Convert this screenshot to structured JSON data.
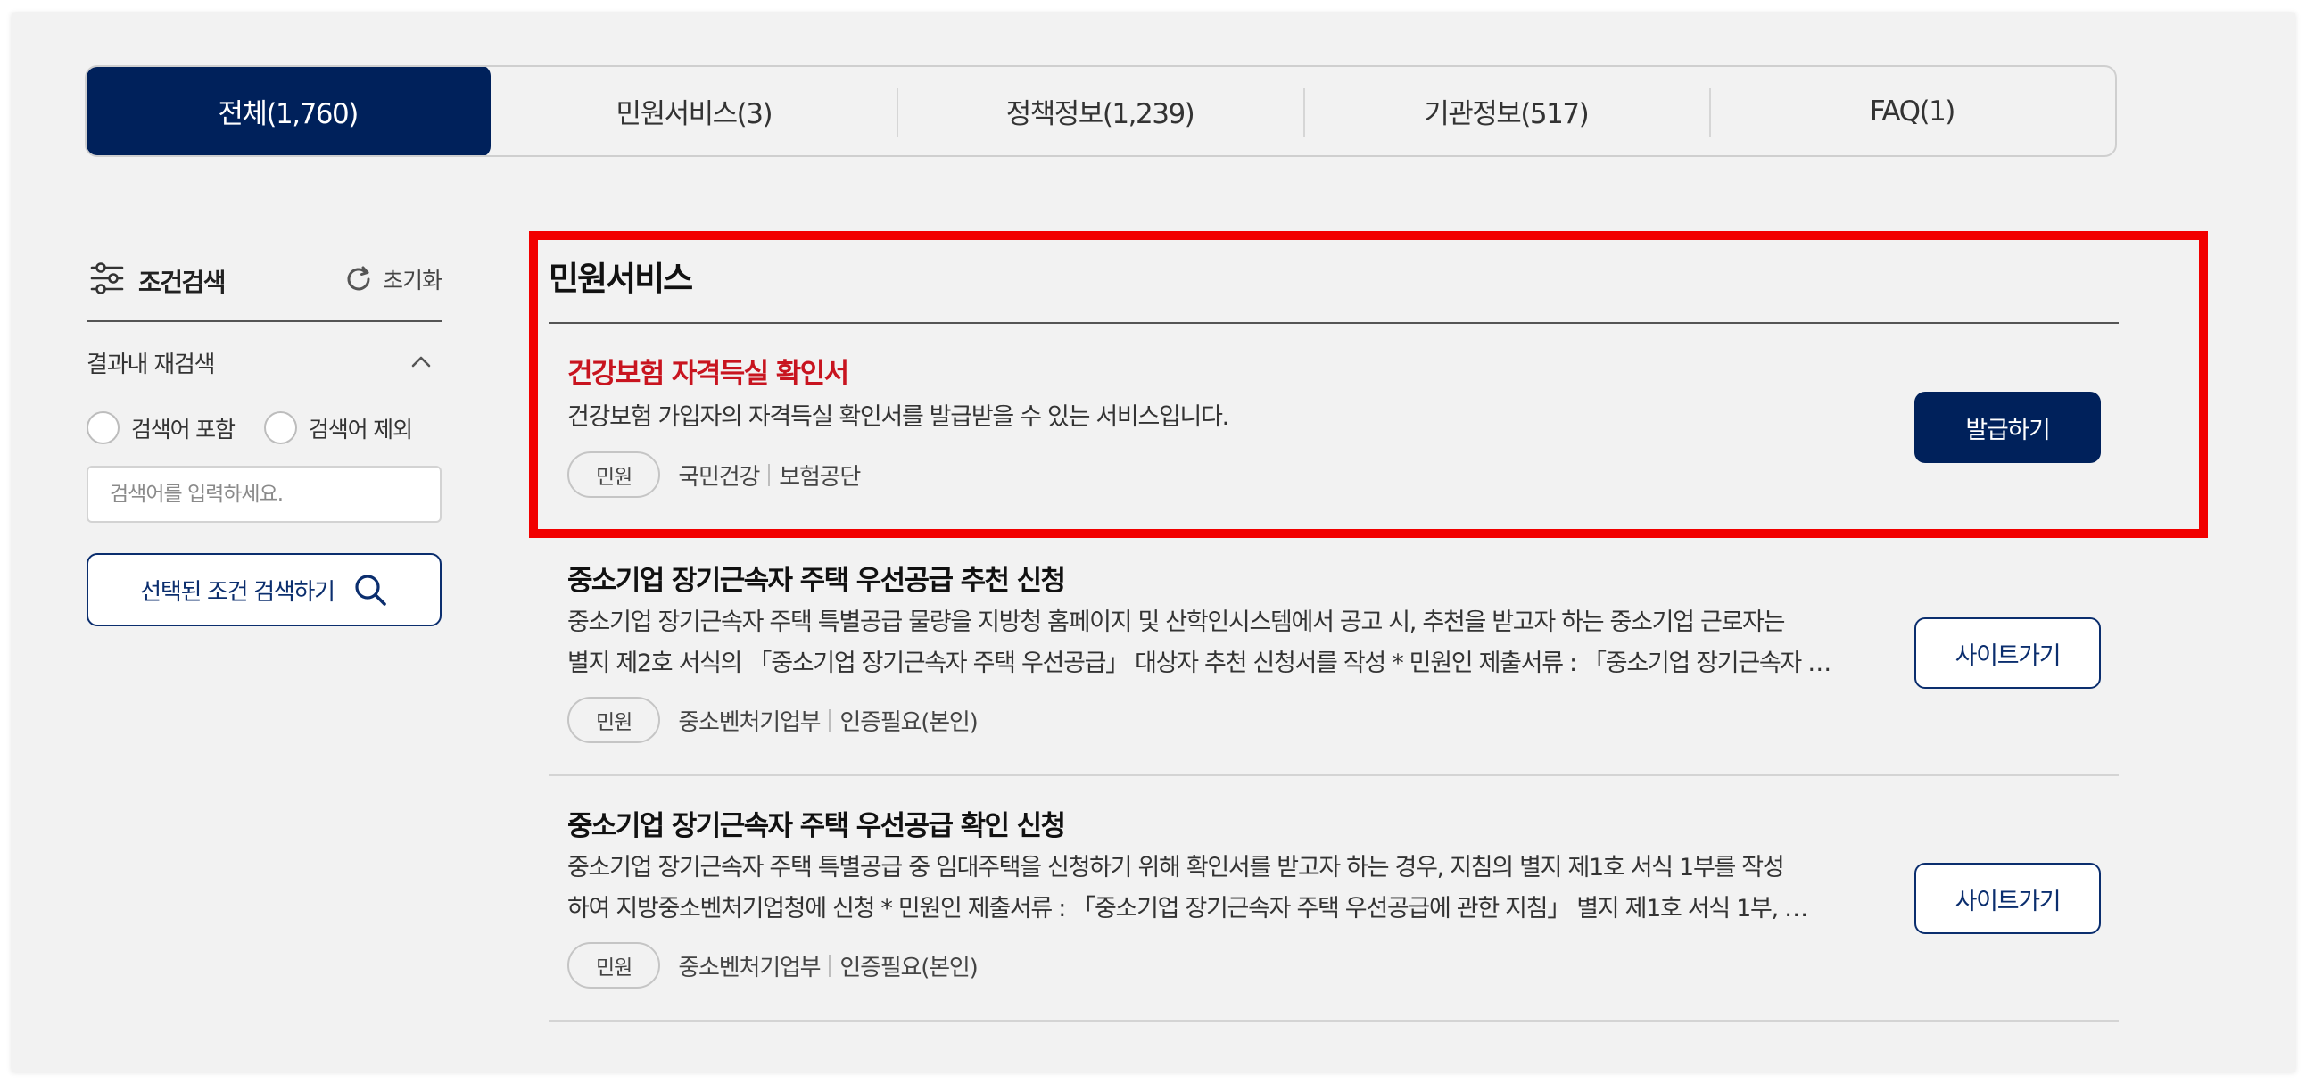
{
  "tabs": [
    {
      "label": "전체(1,760)",
      "active": true
    },
    {
      "label": "민원서비스(3)",
      "active": false
    },
    {
      "label": "정책정보(1,239)",
      "active": false
    },
    {
      "label": "기관정보(517)",
      "active": false
    },
    {
      "label": "FAQ(1)",
      "active": false
    }
  ],
  "filter": {
    "title": "조건검색",
    "reset_label": "초기화",
    "refine_title": "결과내 재검색",
    "include_label": "검색어 포함",
    "exclude_label": "검색어 제외",
    "input_placeholder": "검색어를 입력하세요.",
    "search_button_label": "선택된 조건 검색하기"
  },
  "section": {
    "title": "민원서비스"
  },
  "results": [
    {
      "title": "건강보험 자격득실 확인서",
      "desc_lines": [
        "건강보험 가입자의 자격득실 확인서를 발급받을 수 있는 서비스입니다."
      ],
      "badge": "민원",
      "org": "국민건강",
      "tag": "보험공단",
      "action": "발급하기"
    },
    {
      "title": "중소기업 장기근속자 주택 우선공급 추천 신청",
      "desc_lines": [
        "중소기업 장기근속자 주택 특별공급 물량을 지방청 홈페이지 및 산학인시스템에서 공고 시, 추천을 받고자 하는 중소기업 근로자는",
        "별지 제2호 서식의 「중소기업 장기근속자 주택 우선공급」 대상자 추천 신청서를 작성 * 민원인 제출서류 : 「중소기업 장기근속자 …"
      ],
      "badge": "민원",
      "org": "중소벤처기업부",
      "tag": "인증필요(본인)",
      "action": "사이트가기"
    },
    {
      "title": "중소기업 장기근속자 주택 우선공급 확인 신청",
      "desc_lines": [
        "중소기업 장기근속자 주택 특별공급 중 임대주택을 신청하기 위해 확인서를 받고자 하는 경우, 지침의 별지 제1호 서식 1부를 작성",
        "하여 지방중소벤처기업청에 신청 * 민원인 제출서류 : 「중소기업 장기근속자 주택 우선공급에 관한 지침」 별지 제1호 서식 1부, …"
      ],
      "badge": "민원",
      "org": "중소벤처기업부",
      "tag": "인증필요(본인)",
      "action": "사이트가기"
    }
  ],
  "colors": {
    "navy": "#00215b",
    "highlight": "#f20000",
    "title_red": "#c8141f"
  }
}
